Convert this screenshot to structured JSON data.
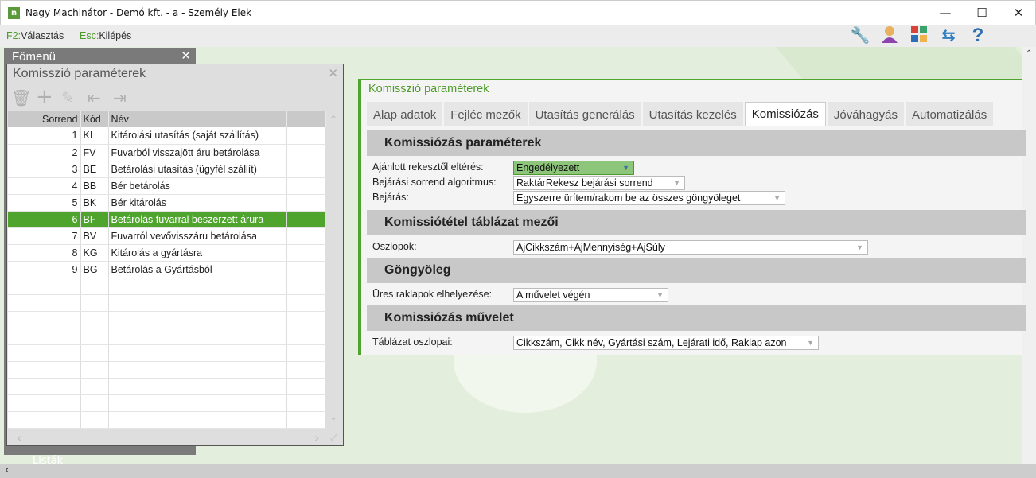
{
  "window": {
    "title": "Nagy Machinátor - Demó kft. - a - Személy Elek",
    "logo": "n"
  },
  "toolbar": {
    "f2_key": "F2:",
    "f2_label": "Választás",
    "esc_key": "Esc:",
    "esc_label": "Kilépés",
    "icons": [
      "wrench-icon",
      "user-icon",
      "apps-icon",
      "swap-icon",
      "help-icon"
    ]
  },
  "fomenu": {
    "title": "Főmenü",
    "item": "Listák"
  },
  "dialog": {
    "title": "Komisszió paraméterek",
    "columns": [
      "Sorrend",
      "Kód",
      "Név"
    ],
    "rows": [
      {
        "sorrend": "1",
        "kod": "KI",
        "nev": "Kitárolási utasítás (saját szállítás)"
      },
      {
        "sorrend": "2",
        "kod": "FV",
        "nev": "Fuvarból visszajött áru betárolása"
      },
      {
        "sorrend": "3",
        "kod": "BE",
        "nev": "Betárolási utasítás (ügyfél szállít)"
      },
      {
        "sorrend": "4",
        "kod": "BB",
        "nev": "Bér betárolás"
      },
      {
        "sorrend": "5",
        "kod": "BK",
        "nev": "Bér kitárolás"
      },
      {
        "sorrend": "6",
        "kod": "BF",
        "nev": "Betárolás fuvarral beszerzett árura"
      },
      {
        "sorrend": "7",
        "kod": "BV",
        "nev": "Fuvarról vevővisszáru betárolása"
      },
      {
        "sorrend": "8",
        "kod": "KG",
        "nev": "Kitárolás a gyártásra"
      },
      {
        "sorrend": "9",
        "kod": "BG",
        "nev": "Betárolás a Gyártásból"
      }
    ],
    "selected_row": 5
  },
  "panel": {
    "title": "Komisszió paraméterek",
    "tabs": [
      "Alap adatok",
      "Fejléc mezők",
      "Utasítás generálás",
      "Utasítás kezelés",
      "Komissiózás",
      "Jóváhagyás",
      "Automatizálás"
    ],
    "active_tab": "Komissiózás",
    "sections": [
      {
        "title": "Komissiózás paraméterek",
        "fields": [
          {
            "label": "Ajánlott rekesztől eltérés:",
            "value": "Engedélyezett"
          },
          {
            "label": "Bejárási sorrend algoritmus:",
            "value": "RaktárRekesz bejárási sorrend"
          },
          {
            "label": "Bejárás:",
            "value": "Egyszerre ürítem/rakom be az összes göngyöleget"
          }
        ]
      },
      {
        "title": "Komissiótétel táblázat mezői",
        "fields": [
          {
            "label": "Oszlopok:",
            "value": "AjCikkszám+AjMennyiség+AjSúly"
          }
        ]
      },
      {
        "title": "Göngyöleg",
        "fields": [
          {
            "label": "Üres raklapok elhelyezése:",
            "value": "A művelet végén"
          }
        ]
      },
      {
        "title": "Komissiózás művelet",
        "fields": [
          {
            "label": "Táblázat oszlopai:",
            "value": "Cikkszám, Cikk név, Gyártási szám, Lejárati idő, Raklap azon"
          }
        ]
      }
    ]
  },
  "colors": {
    "accent": "#4ea42c",
    "background": "#e3efdc"
  }
}
